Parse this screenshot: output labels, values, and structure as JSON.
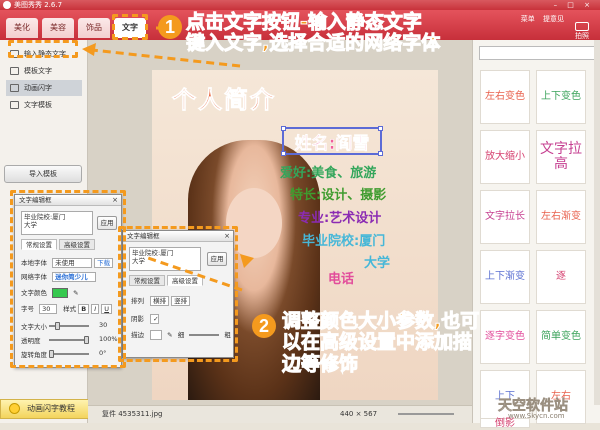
{
  "app": {
    "title": "美图秀秀 2.6.7",
    "window_controls": "– □ ×"
  },
  "tabs": [
    "美化",
    "美容",
    "饰品",
    "文字"
  ],
  "top_menu": {
    "menu": "菜单",
    "feedback": "提意见"
  },
  "photo_button": "拍照",
  "sidebar": {
    "items": [
      {
        "label": "输入静态文字"
      },
      {
        "label": "模板文字"
      },
      {
        "label": "动画闪字"
      },
      {
        "label": "文字模板"
      }
    ],
    "import_label": "导入模板",
    "tutorial_label": "动画闪字教程"
  },
  "poster": {
    "title": "个人简介",
    "name": "姓名:阎雪",
    "lines": [
      {
        "text": "爱好:美食、旅游",
        "color": "#33a65b"
      },
      {
        "text": "特长:设计、摄影",
        "color": "#3f9c2f"
      },
      {
        "text": "专业:艺术设计",
        "color": "#8b2bb3"
      },
      {
        "text": "毕业院校:厦门",
        "color": "#46b7d8"
      },
      {
        "text": "大学",
        "color": "#46b7d8"
      },
      {
        "text": "电话",
        "color": "#e24d9b"
      }
    ]
  },
  "status": {
    "filename": "复件 4535311.jpg",
    "dimensions": "440 × 567"
  },
  "style_panel": {
    "cells": [
      {
        "label": "左右变色",
        "color": "#e8604c"
      },
      {
        "label": "上下变色",
        "color": "#3aa35a"
      },
      {
        "label": "放大缩小",
        "color": "#d5406f"
      },
      {
        "label": "文字拉高",
        "color": "#c64091"
      },
      {
        "label": "文字拉长",
        "color": "#c64091"
      },
      {
        "label": "左右渐变",
        "color": "#e8604c"
      },
      {
        "label": "上下渐变",
        "color": "#5a6fd1"
      },
      {
        "label": "逐",
        "color": "#d5406f"
      },
      {
        "label": "逐字变色",
        "color": "#e24d9b"
      },
      {
        "label": "简单变色",
        "color": "#3aa35a"
      },
      {
        "label": "上下",
        "color": "#5a6fd1"
      },
      {
        "label": "左右",
        "color": "#e8604c"
      },
      {
        "label": "倒影",
        "color": "#d5406f"
      }
    ]
  },
  "editor_basic": {
    "title": "文字编辑框",
    "text_value": "毕业院校:厦门\n大学",
    "apply": "应用",
    "tab_normal": "常规设置",
    "tab_advanced": "高级设置",
    "font_label": "本地字体",
    "font_value": "未使用",
    "download": "下载",
    "net_font_label": "网络字体",
    "net_font_value": "迷你简少儿",
    "color_label": "文字颜色",
    "size_label": "字号",
    "size_value": "30",
    "style_label": "样式",
    "style_b": "B",
    "style_i": "I",
    "style_u": "U",
    "font_size_label": "文字大小",
    "font_size_value": "30",
    "opacity_label": "透明度",
    "opacity_value": "100%",
    "rotate_label": "旋转角度",
    "rotate_value": "0°"
  },
  "editor_advanced": {
    "title": "文字编辑框",
    "text_value": "毕业院校:厦门\n大学",
    "apply": "应用",
    "tab_normal": "常规设置",
    "tab_advanced": "高级设置",
    "layout_label": "排列",
    "horizontal": "横排",
    "vertical": "竖排",
    "shadow_label": "阴影",
    "stroke_label": "描边",
    "thin": "细",
    "thick": "粗"
  },
  "callout_1": {
    "number": "1",
    "text": "点击文字按钮-输入静态文字\n键入文字,选择合适的网络字体"
  },
  "callout_2": {
    "number": "2",
    "text": "调整颜色大小参数,也可\n以在高级设置中添加描\n边等修饰"
  },
  "watermark": {
    "text": "天空软件站",
    "url": "www.Skycn.com"
  }
}
